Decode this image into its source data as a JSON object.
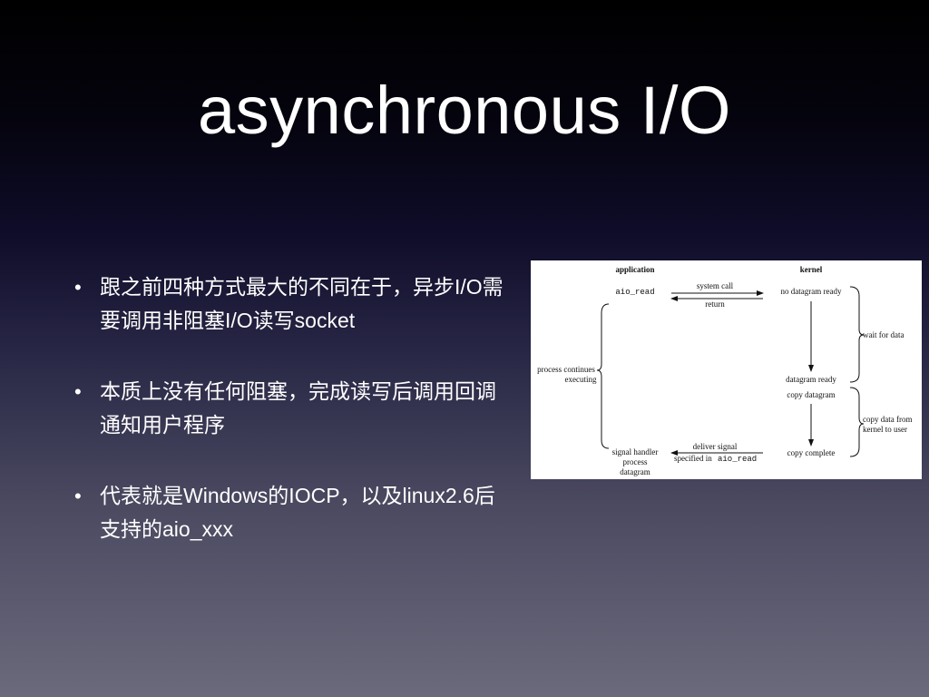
{
  "slide": {
    "title": "asynchronous I/O",
    "bullet_glyph": "•",
    "bullets": [
      "跟之前四种方式最大的不同在于，异步I/O需要调用非阻塞I/O读写socket",
      "本质上没有任何阻塞，完成读写后调用回调通知用户程序",
      "代表就是Windows的IOCP，以及linux2.6后支持的aio_xxx"
    ]
  },
  "figure": {
    "application_header": "application",
    "kernel_header": "kernel",
    "aio_read": "aio_read",
    "system_call": "system call",
    "return_label": "return",
    "no_datagram_ready": "no datagram ready",
    "wait_for_data": "wait for data",
    "process_continues": "process continues",
    "executing": "executing",
    "datagram_ready": "datagram ready",
    "copy_datagram": "copy datagram",
    "copy_data_from": "copy data from",
    "kernel_to_user": "kernel to user",
    "signal_handler": "signal handler",
    "process": "process",
    "datagram": "datagram",
    "deliver_signal": "deliver signal",
    "specified_in": "specified in",
    "specified_call": "aio_read",
    "copy_complete": "copy complete"
  }
}
